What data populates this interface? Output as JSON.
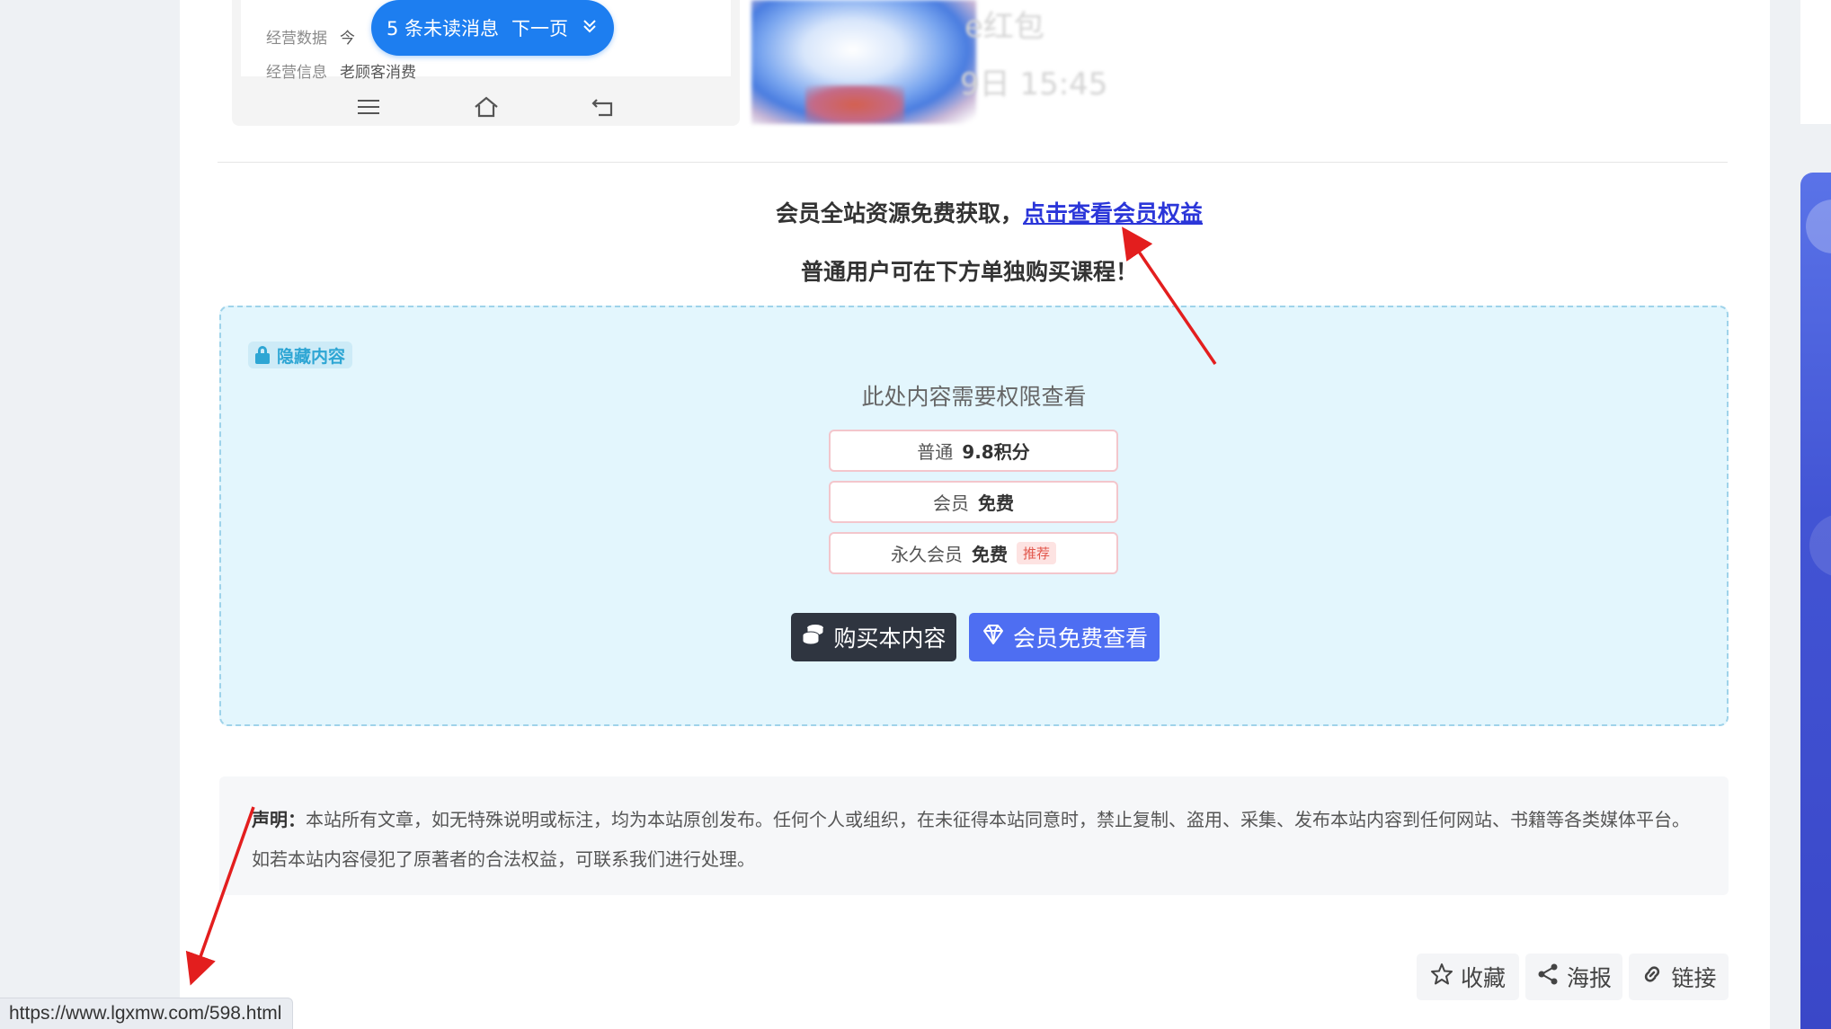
{
  "phone_shot": {
    "row1_label": "经营数据",
    "row1_value": "今",
    "row2_label": "经营信息",
    "row2_value": "老顾客消费",
    "unread_text": "5 条未读消息",
    "next_page": "下一页",
    "blur_line1": "e红包",
    "blur_line2": "9日 15:45"
  },
  "promo": {
    "line1_prefix": "会员全站资源免费获取，",
    "line1_link": "点击查看会员权益",
    "line2": "普通用户可在下方单独购买课程！"
  },
  "hidden": {
    "tag": "隐藏内容",
    "need_permission": "此处内容需要权限查看",
    "prices": [
      {
        "tier": "普通",
        "price": "9.8积分",
        "badge": ""
      },
      {
        "tier": "会员",
        "price": "免费",
        "badge": ""
      },
      {
        "tier": "永久会员",
        "price": "免费",
        "badge": "推荐"
      }
    ],
    "buy_button": "购买本内容",
    "vip_button": "会员免费查看"
  },
  "disclaimer": {
    "label": "声明：",
    "text": "本站所有文章，如无特殊说明或标注，均为本站原创发布。任何个人或组织，在未征得本站同意时，禁止复制、盗用、采集、发布本站内容到任何网站、书籍等各类媒体平台。如若本站内容侵犯了原著者的合法权益，可联系我们进行处理。"
  },
  "actions": {
    "favorite": "收藏",
    "poster": "海报",
    "link": "链接"
  },
  "status_url": "https://www.lgxmw.com/598.html",
  "colors": {
    "link_blue": "#2b36d9",
    "hidden_bg": "#e3f6fd",
    "vip_button": "#4e6ef2",
    "buy_button": "#2f3540",
    "arrow_red": "#e31e1e"
  }
}
